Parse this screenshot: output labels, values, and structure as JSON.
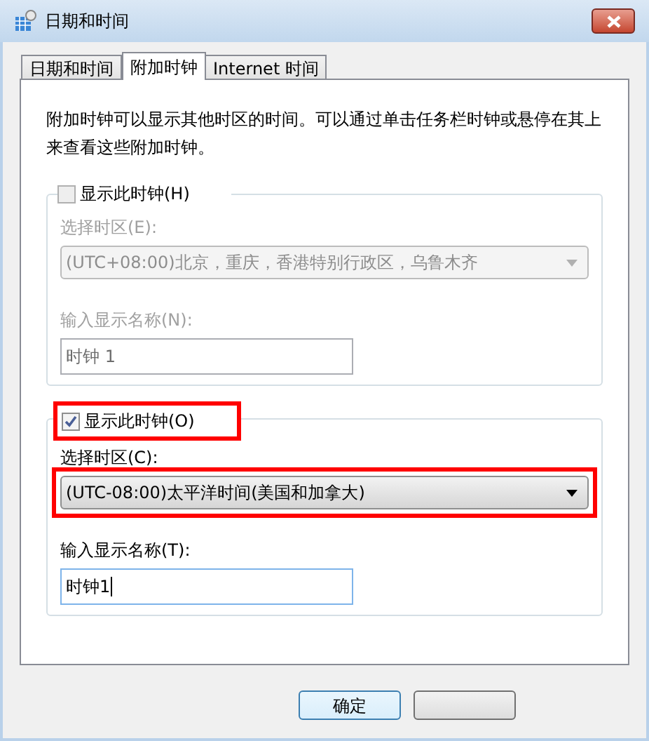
{
  "window": {
    "title": "日期和时间"
  },
  "tabs": [
    {
      "label": "日期和时间",
      "selected": false
    },
    {
      "label": "附加时钟",
      "selected": true
    },
    {
      "label": "Internet 时间",
      "selected": false
    }
  ],
  "description": "附加时钟可以显示其他时区的时间。可以通过单击任务栏时钟或悬停在其上来查看这些附加时钟。",
  "clocks": [
    {
      "checkbox": {
        "label": "显示此时钟(H)",
        "checked": false,
        "highlighted": false
      },
      "timezone_label": "选择时区(E):",
      "timezone": {
        "value": "(UTC+08:00)北京，重庆，香港特别行政区，乌鲁木齐",
        "highlighted": false
      },
      "name_label": "输入显示名称(N):",
      "name": {
        "value": "时钟 1",
        "focused": false
      },
      "disabled": true
    },
    {
      "checkbox": {
        "label": "显示此时钟(O)",
        "checked": true,
        "highlighted": true
      },
      "timezone_label": "选择时区(C):",
      "timezone": {
        "value": "(UTC-08:00)太平洋时间(美国和加拿大)",
        "highlighted": true
      },
      "name_label": "输入显示名称(T):",
      "name": {
        "value": "时钟1",
        "focused": true
      },
      "disabled": false
    }
  ],
  "buttons": [
    {
      "label": "确定",
      "kind": "default"
    },
    {
      "kind": "blank"
    }
  ]
}
